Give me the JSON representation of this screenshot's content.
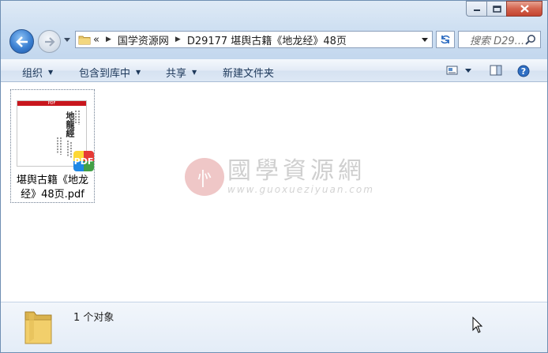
{
  "address_bar": {
    "overflow_chevron": "«",
    "crumbs": [
      "国学资源网",
      "D29177 堪舆古籍《地龙经》48页"
    ]
  },
  "search": {
    "placeholder": "搜索 D29..."
  },
  "toolbar": {
    "organize": "组织",
    "include_in_library": "包含到库中",
    "share": "共享",
    "new_folder": "新建文件夹"
  },
  "files": [
    {
      "name_line1": "堪舆古籍《地龙",
      "name_line2": "经》48页.pdf",
      "thumbnail": {
        "banner": "PDF",
        "title": "地龍經",
        "badge": "PDF"
      }
    }
  ],
  "watermark": {
    "chinese": "國學資源網",
    "url": "www.guoxueziyuan.com"
  },
  "status": {
    "item_count": "1 个对象"
  },
  "colors": {
    "close_button": "#c34430",
    "toolbar_text": "#1e395b",
    "pdf_banner": "#c8161d"
  },
  "icons": [
    "minimize-icon",
    "maximize-icon",
    "close-icon",
    "back-arrow-icon",
    "forward-arrow-icon",
    "folder-icon",
    "refresh-icon",
    "search-icon",
    "view-options-icon",
    "preview-pane-icon",
    "help-icon",
    "pdf-icon",
    "cursor-icon"
  ]
}
